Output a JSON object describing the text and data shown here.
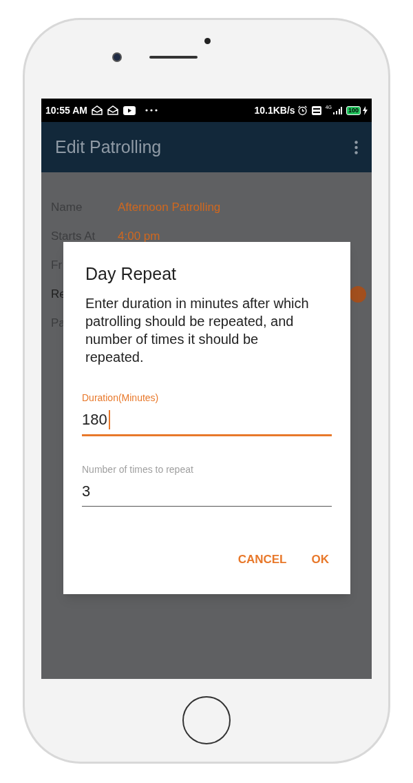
{
  "status_bar": {
    "time": "10:55 AM",
    "speed": "10.1KB/s",
    "network": "4G",
    "battery": "100"
  },
  "app_bar": {
    "title": "Edit Patrolling"
  },
  "form": {
    "rows": [
      {
        "label": "Name",
        "value": "Afternoon Patrolling"
      },
      {
        "label": "Starts At",
        "value": "4:00 pm"
      },
      {
        "label": "Fr"
      },
      {
        "label": "Re",
        "switch_on": true
      },
      {
        "label": "Pa"
      }
    ]
  },
  "dialog": {
    "title": "Day Repeat",
    "message": "Enter duration in minutes after which patrolling should be repeated, and number of times it should be repeated.",
    "fields": [
      {
        "label": "Duration(Minutes)",
        "value": "180",
        "focused": true
      },
      {
        "label": "Number of times to repeat",
        "value": "3",
        "focused": false
      }
    ],
    "buttons": [
      "CANCEL",
      "OK"
    ]
  }
}
